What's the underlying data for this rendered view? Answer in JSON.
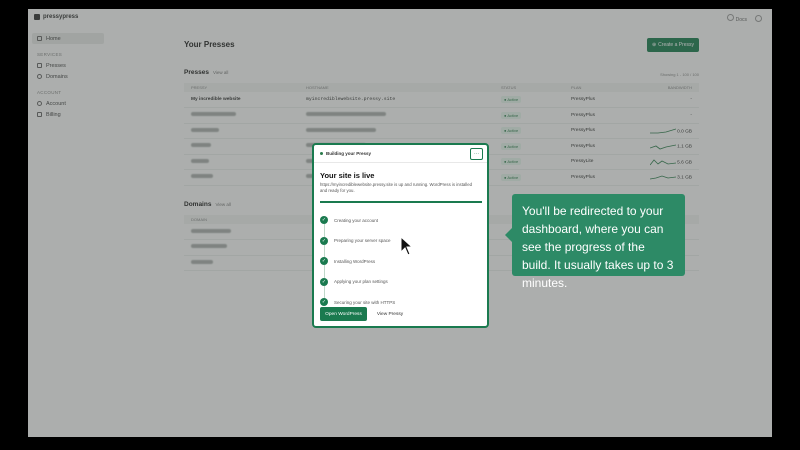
{
  "app": {
    "name": "pressypress",
    "top_right": {
      "docs_label": "Docs"
    }
  },
  "sidebar": {
    "home": "Home",
    "services_section": "SERVICES",
    "services": [
      "Presses",
      "Domains"
    ],
    "account_section": "ACCOUNT",
    "account": [
      "Account",
      "Billing"
    ]
  },
  "main": {
    "title": "Your Presses",
    "create_button": "Create a Pressy",
    "presses": {
      "heading": "Presses",
      "view_all": "View all",
      "pager": "Showing 1 - 100 / 100",
      "columns": [
        "PRESSY",
        "HOSTNAME",
        "STATUS",
        "PLAN",
        "BANDWIDTH"
      ],
      "rows": [
        {
          "name": "My incredible website",
          "host": "myincrediblewebsite.pressy.site",
          "status": "Active",
          "plan": "PressyPlus",
          "bw": "-"
        },
        {
          "name": "",
          "host": "",
          "status": "Active",
          "plan": "PressyPlus",
          "bw": "-"
        },
        {
          "name": "",
          "host": "",
          "status": "Active",
          "plan": "PressyPlus",
          "bw": "0.0 GB"
        },
        {
          "name": "",
          "host": "",
          "status": "Active",
          "plan": "PressyPlus",
          "bw": "1.1 GB"
        },
        {
          "name": "",
          "host": "",
          "status": "Active",
          "plan": "PressyLite",
          "bw": "5.6 GB"
        },
        {
          "name": "",
          "host": "",
          "status": "Active",
          "plan": "PressyPlus",
          "bw": "3.1 GB"
        }
      ]
    },
    "domains": {
      "heading": "Domains",
      "view_all": "View all",
      "columns": [
        "DOMAIN"
      ]
    }
  },
  "modal": {
    "header": "Building your Pressy",
    "more": "···",
    "title": "Your site is live",
    "description": "https://myincrediblewebsite.pressy.site is up and running. WordPress is installed and ready for you.",
    "progress": 1.0,
    "steps": [
      "Creating your account",
      "Preparing your server space",
      "Installing WordPress",
      "Applying your plan settings",
      "Securing your site with HTTPS"
    ],
    "primary_button": "Open WordPress",
    "secondary_button": "View Pressy"
  },
  "callout": {
    "text": "You'll be redirected to your dashboard, where you can see the progress of the build. It usually takes up to 3 minutes."
  },
  "colors": {
    "accent": "#1a7a4f",
    "callout": "#2d8a66"
  }
}
